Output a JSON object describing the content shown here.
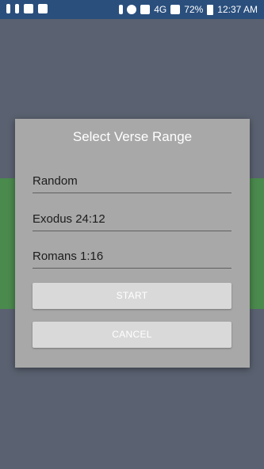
{
  "status_bar": {
    "battery": "72%",
    "time": "12:37 AM",
    "network_label": "4G",
    "icons_left": [
      "notification-icon",
      "alert-icon",
      "phone-icon",
      "youtube-icon"
    ],
    "icons_right": [
      "bluetooth-icon",
      "alarm-icon",
      "wifi-icon",
      "signal-icon",
      "battery-icon"
    ]
  },
  "dialog": {
    "title": "Select Verse Range",
    "mode_field": "Random",
    "start_verse": "Exodus 24:12",
    "end_verse": "Romans 1:16",
    "start_button": "START",
    "cancel_button": "CANCEL"
  },
  "colors": {
    "status_bar": "#2a4f7d",
    "background": "#5a6170",
    "green_band": "#4a8a4d",
    "dialog": "#a8a8a8",
    "button": "#d9d9d9"
  }
}
